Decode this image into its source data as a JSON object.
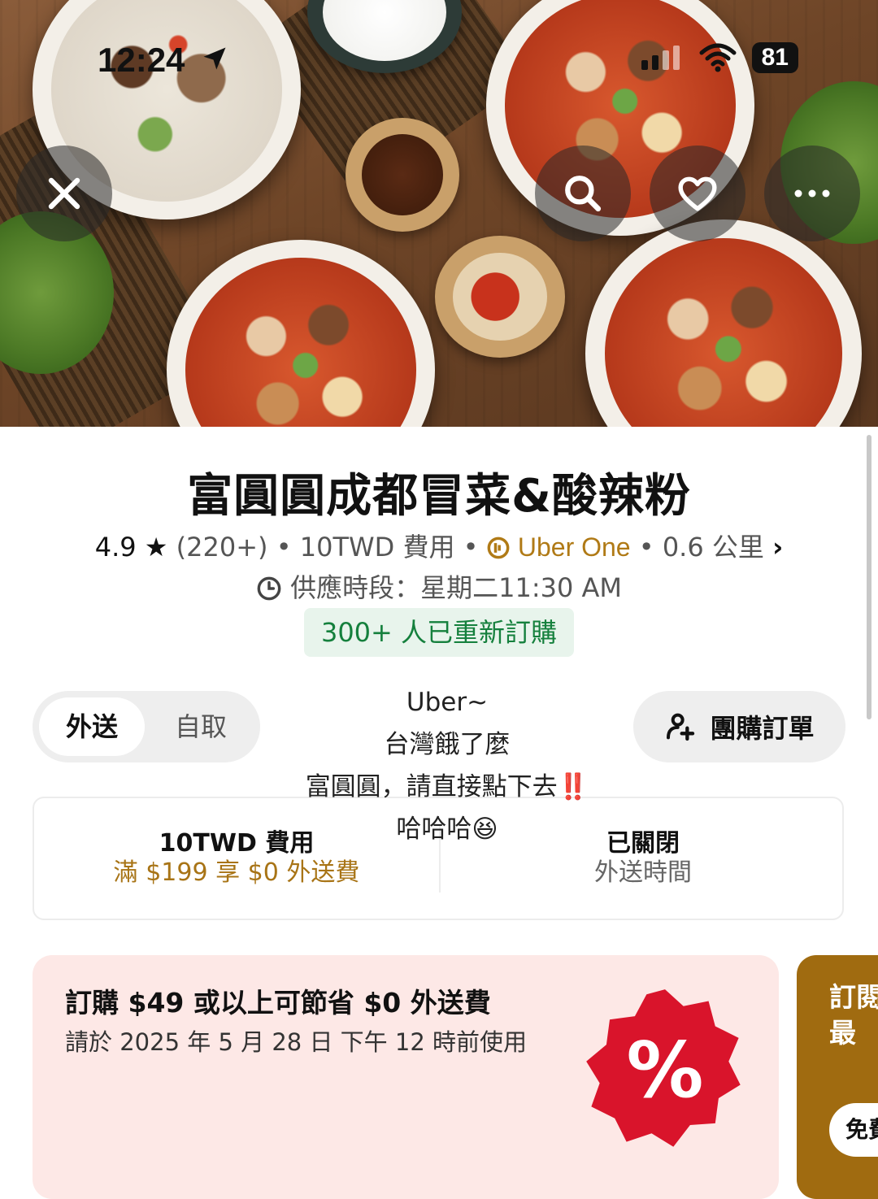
{
  "status_bar": {
    "time": "12:24",
    "battery": "81"
  },
  "hero": {
    "close_icon": "close-icon",
    "search_icon": "search-icon",
    "favorite_icon": "heart-icon",
    "more_icon": "more-icon"
  },
  "store": {
    "name": "富圓圓成都冒菜&酸辣粉",
    "rating": "4.9",
    "rating_count": "(220+)",
    "fee": "10TWD 費用",
    "membership": "Uber One",
    "distance": "0.6 公里",
    "hours": "供應時段：星期二11:30 AM",
    "reorder_badge": "300+ 人已重新訂購"
  },
  "mode_toggle": {
    "delivery": "外送",
    "pickup": "自取",
    "selected": "外送"
  },
  "group_order": {
    "label": "團購訂單"
  },
  "caption": {
    "line1": "Uber~",
    "line2": "台灣餓了麼",
    "line3": "富圓圓，請直接點下去",
    "line3_emoji": "‼️",
    "line4": "哈哈哈",
    "line4_emoji": "😆"
  },
  "fee_card": {
    "left_title": "10TWD 費用",
    "left_sub": "滿 $199 享 $0 外送費",
    "right_title": "已關閉",
    "right_sub": "外送時間"
  },
  "promo": {
    "title": "訂購 $49 或以上可節省 $0 外送費",
    "subtitle": "請於 2025 年 5 月 28 日 下午 12 時前使用",
    "badge_symbol": "%"
  },
  "promo2": {
    "title": "訂閱費最",
    "pill": "免費"
  },
  "colors": {
    "accent_green": "#15803d",
    "uber_one_gold": "#b07a16",
    "promo_bg": "#fde8e6",
    "promo_badge": "#d9142b",
    "promo2_bg": "#a06b10"
  }
}
